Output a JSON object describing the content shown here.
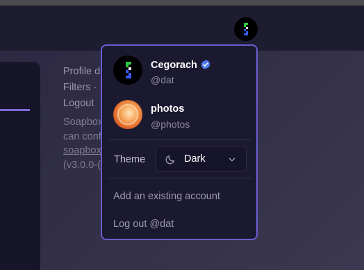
{
  "sidebar": {
    "links": [
      "Profile d",
      "Filters ·",
      "Logout"
    ],
    "footer_lines": [
      "Soapbox",
      "can conf"
    ],
    "footer_link": "soapbox",
    "footer_version": "(v3.0.0-("
  },
  "account_menu": {
    "accounts": [
      {
        "name": "Cegorach",
        "handle": "@dat",
        "verified": true,
        "avatar_icon": "pixel-figure-avatar"
      },
      {
        "name": "photos",
        "handle": "@photos",
        "verified": false,
        "avatar_icon": "photo-avatar"
      }
    ],
    "theme": {
      "label": "Theme",
      "value": "Dark"
    },
    "add_account": "Add an existing account",
    "logout": "Log out @dat"
  },
  "colors": {
    "accent": "#6a5ed0",
    "verified": "#4f7bf0",
    "menu_bg": "#1b1930"
  }
}
